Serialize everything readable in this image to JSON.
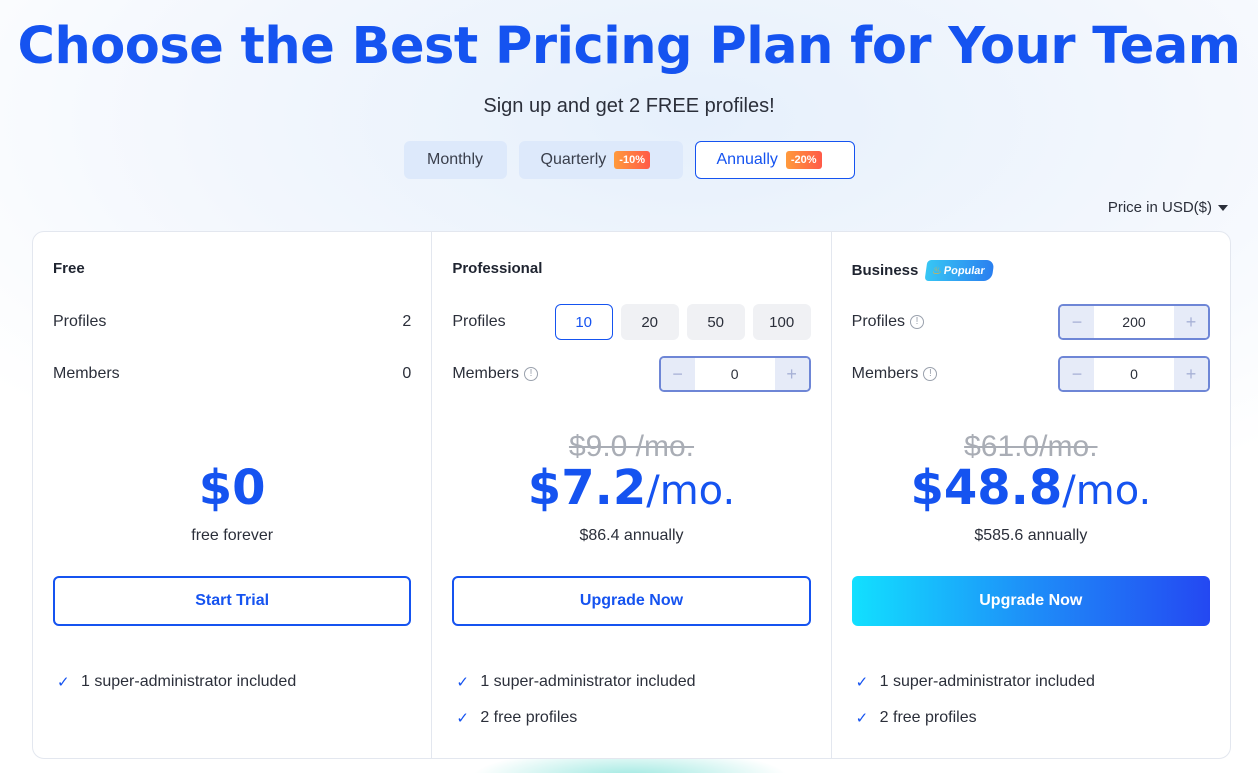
{
  "hero": {
    "title": "Choose the Best Pricing Plan for Your Team",
    "subtitle": "Sign up and get 2 FREE profiles!"
  },
  "billing": {
    "monthly_label": "Monthly",
    "quarterly_label": "Quarterly",
    "quarterly_discount": "-10%",
    "annually_label": "Annually",
    "annually_discount": "-20%",
    "selected": "Annually"
  },
  "currency": {
    "label": "Price in USD($)"
  },
  "plans": [
    {
      "name": "Free",
      "profiles_label": "Profiles",
      "profiles_value": "2",
      "members_label": "Members",
      "members_value": "0",
      "price": "$0",
      "price_note": "free forever",
      "cta": "Start Trial",
      "features": [
        "1 super-administrator included"
      ]
    },
    {
      "name": "Professional",
      "profiles_label": "Profiles",
      "profile_options": [
        "10",
        "20",
        "50",
        "100"
      ],
      "profile_selected": "10",
      "members_label": "Members",
      "members_value": "0",
      "price_old": "$9.0 /mo.",
      "price": "$7.2",
      "price_unit": "/mo.",
      "price_note": "$86.4 annually",
      "cta": "Upgrade Now",
      "features": [
        "1 super-administrator included",
        "2 free profiles"
      ]
    },
    {
      "name": "Business",
      "badge": "Popular",
      "profiles_label": "Profiles",
      "profiles_value": "200",
      "members_label": "Members",
      "members_value": "0",
      "price_old": "$61.0/mo.",
      "price": "$48.8",
      "price_unit": "/mo.",
      "price_note": "$585.6 annually",
      "cta": "Upgrade Now",
      "features": [
        "1 super-administrator included",
        "2 free profiles"
      ]
    }
  ],
  "stepper": {
    "minus": "−",
    "plus": "+"
  },
  "icons": {
    "check": "check-icon",
    "info": "info-icon",
    "flame": "flame-icon",
    "caret": "caret-down-icon"
  },
  "colors": {
    "accent": "#1553f0",
    "badge_orange": "#ff7043",
    "popular_blue": "#2a9df0"
  }
}
